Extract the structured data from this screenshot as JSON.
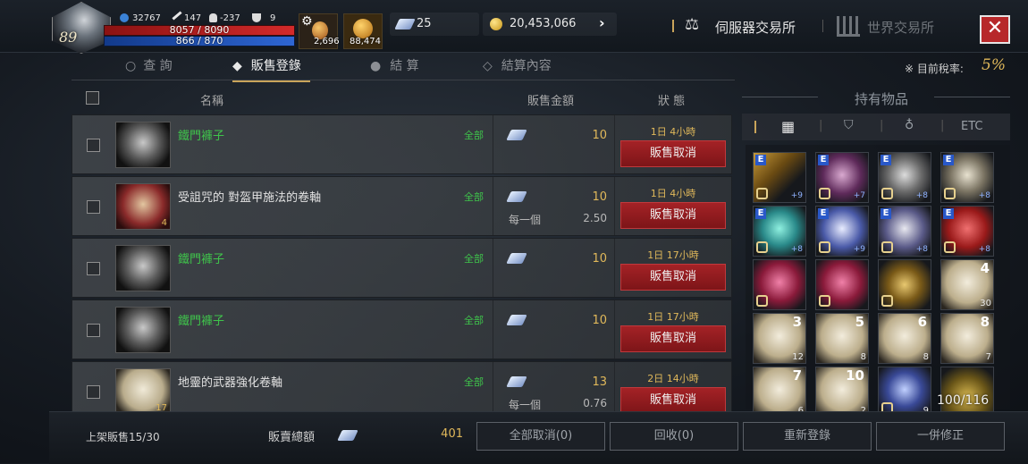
{
  "header": {
    "level": "89",
    "power": "32767",
    "attack": "147",
    "karma": "-237",
    "trophy": "9",
    "hp": "8057 / 8090",
    "mp": "866 / 870",
    "slot1_count": "2,696",
    "slot2_count": "88,474",
    "diamond": "25",
    "gold": "20,453,066",
    "nav_server": "伺服器交易所",
    "nav_world": "世界交易所"
  },
  "tabs": [
    {
      "label": "查 詢"
    },
    {
      "label": "販售登錄"
    },
    {
      "label": "結 算"
    },
    {
      "label": "結算內容"
    }
  ],
  "tax": {
    "label": "※ 目前稅率:",
    "value": "5%"
  },
  "columns": {
    "name": "名稱",
    "price": "販售金額",
    "status": "狀 態"
  },
  "listings": [
    {
      "name": "鐵門褲子",
      "color": "green",
      "scope": "全部",
      "price": "10",
      "each_label": "",
      "each_value": "",
      "time": "1日 4小時",
      "count": "",
      "action": "販售取消"
    },
    {
      "name": "受詛咒的 對盔甲施法的卷軸",
      "color": "white",
      "scope": "全部",
      "price": "10",
      "each_label": "每一個",
      "each_value": "2.50",
      "time": "1日 4小時",
      "count": "4",
      "action": "販售取消"
    },
    {
      "name": "鐵門褲子",
      "color": "green",
      "scope": "全部",
      "price": "10",
      "each_label": "",
      "each_value": "",
      "time": "1日 17小時",
      "count": "",
      "action": "販售取消"
    },
    {
      "name": "鐵門褲子",
      "color": "green",
      "scope": "全部",
      "price": "10",
      "each_label": "",
      "each_value": "",
      "time": "1日 17小時",
      "count": "",
      "action": "販售取消"
    },
    {
      "name": "地靈的武器強化卷軸",
      "color": "white",
      "scope": "全部",
      "price": "13",
      "each_label": "每一個",
      "each_value": "0.76",
      "time": "2日 14小時",
      "count": "17",
      "action": "販售取消"
    }
  ],
  "inventory": {
    "title": "持有物品",
    "filter_etc": "ETC",
    "count": "100/116",
    "cells": [
      {
        "name": "sword",
        "enh": "+9",
        "big": "",
        "qty": ""
      },
      {
        "name": "robe",
        "enh": "+7",
        "big": "",
        "qty": ""
      },
      {
        "name": "armor",
        "enh": "+8",
        "big": "",
        "qty": ""
      },
      {
        "name": "boots",
        "enh": "+8",
        "big": "",
        "qty": ""
      },
      {
        "name": "glove",
        "enh": "+8",
        "big": "",
        "qty": ""
      },
      {
        "name": "shield",
        "enh": "+9",
        "big": "",
        "qty": ""
      },
      {
        "name": "helm",
        "enh": "+8",
        "big": "",
        "qty": ""
      },
      {
        "name": "cloak",
        "enh": "+8",
        "big": "",
        "qty": ""
      },
      {
        "name": "ring",
        "enh": "",
        "big": "",
        "qty": ""
      },
      {
        "name": "ring",
        "enh": "",
        "big": "",
        "qty": ""
      },
      {
        "name": "belt",
        "enh": "",
        "big": "",
        "qty": ""
      },
      {
        "name": "scroll",
        "enh": "",
        "big": "4",
        "qty": "30"
      },
      {
        "name": "scroll",
        "enh": "",
        "big": "3",
        "qty": "12"
      },
      {
        "name": "scroll",
        "enh": "",
        "big": "5",
        "qty": "8"
      },
      {
        "name": "scroll",
        "enh": "",
        "big": "6",
        "qty": "8"
      },
      {
        "name": "scroll",
        "enh": "",
        "big": "8",
        "qty": "7"
      },
      {
        "name": "scroll",
        "enh": "",
        "big": "7",
        "qty": "6"
      },
      {
        "name": "scroll",
        "enh": "",
        "big": "10",
        "qty": "2"
      },
      {
        "name": "crystal",
        "enh": "",
        "big": "",
        "qty": "9"
      },
      {
        "name": "coins",
        "enh": "",
        "big": "",
        "qty": ""
      }
    ]
  },
  "footer": {
    "listed": "上架販售15/30",
    "total_label": "販賣總額",
    "total_value": "401",
    "cancel_all": "全部取消(0)",
    "reclaim": "回收(0)",
    "relist": "重新登錄",
    "modify": "一併修正"
  }
}
